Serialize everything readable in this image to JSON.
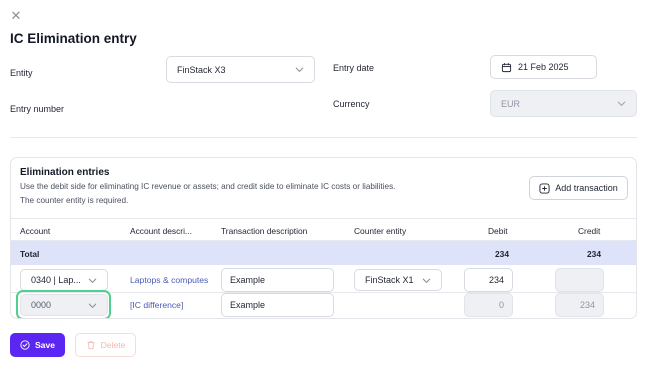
{
  "dialog": {
    "title": "IC Elimination entry"
  },
  "form": {
    "entity_label": "Entity",
    "entity_value": "FinStack X3",
    "entry_number_label": "Entry number",
    "entry_date_label": "Entry date",
    "entry_date_value": "21 Feb 2025",
    "currency_label": "Currency",
    "currency_value": "EUR"
  },
  "eliminations": {
    "title": "Elimination entries",
    "description_line1": "Use the debit side for eliminating IC revenue or assets; and credit side to eliminate IC costs or liabilities.",
    "description_line2": "The counter entity is required.",
    "add_button_label": "Add transaction",
    "columns": [
      "Account",
      "Account descri...",
      "Transaction description",
      "Counter entity",
      "Debit",
      "Credit"
    ],
    "total": {
      "label": "Total",
      "debit": "234",
      "credit": "234"
    },
    "rows": [
      {
        "account": "0340 | Lap...",
        "account_description": "Laptops & computes",
        "transaction_description": "Example",
        "counter_entity": "FinStack X1",
        "debit": "234",
        "credit": ""
      },
      {
        "account": "0000",
        "account_description": "[IC difference]",
        "transaction_description": "Example",
        "counter_entity": "",
        "debit": "0",
        "credit": "234"
      }
    ]
  },
  "footer": {
    "save_label": "Save",
    "delete_label": "Delete"
  },
  "colors": {
    "primary": "#5b26f2",
    "total_row_bg": "#dfe3f9",
    "highlight": "#4fd08c",
    "link_text": "#4a5bb5"
  }
}
